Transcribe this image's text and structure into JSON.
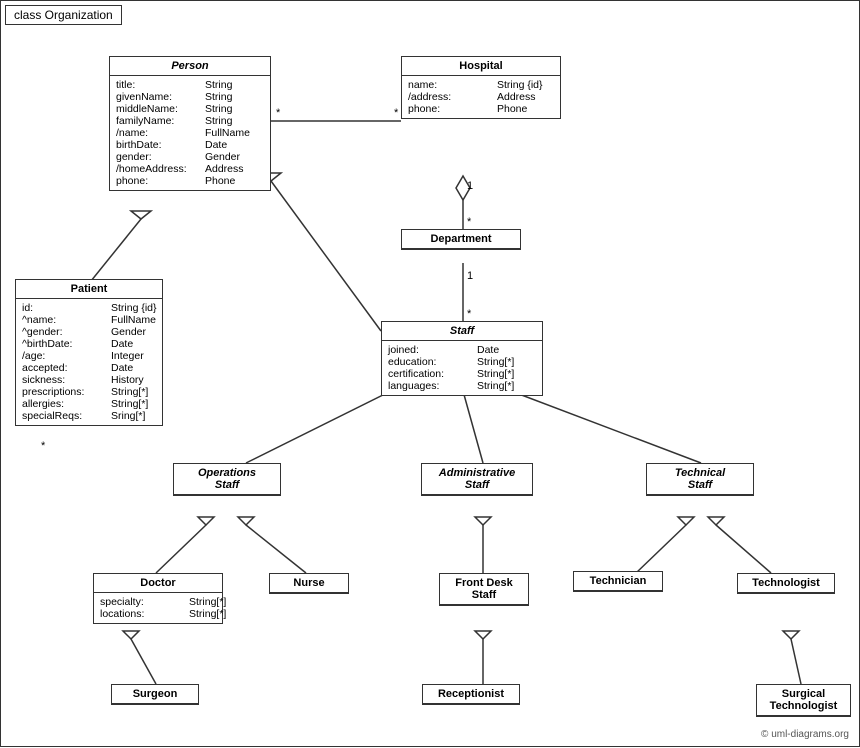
{
  "diagram": {
    "title": "class Organization",
    "copyright": "© uml-diagrams.org",
    "classes": {
      "person": {
        "name": "Person",
        "italic": true,
        "attrs": [
          [
            "title:",
            "String"
          ],
          [
            "givenName:",
            "String"
          ],
          [
            "middleName:",
            "String"
          ],
          [
            "familyName:",
            "String"
          ],
          [
            "/name:",
            "FullName"
          ],
          [
            "birthDate:",
            "Date"
          ],
          [
            "gender:",
            "Gender"
          ],
          [
            "/homeAddress:",
            "Address"
          ],
          [
            "phone:",
            "Phone"
          ]
        ]
      },
      "hospital": {
        "name": "Hospital",
        "italic": false,
        "attrs": [
          [
            "name:",
            "String {id}"
          ],
          [
            "/address:",
            "Address"
          ],
          [
            "phone:",
            "Phone"
          ]
        ]
      },
      "patient": {
        "name": "Patient",
        "italic": false,
        "attrs": [
          [
            "id:",
            "String {id}"
          ],
          [
            "^name:",
            "FullName"
          ],
          [
            "^gender:",
            "Gender"
          ],
          [
            "^birthDate:",
            "Date"
          ],
          [
            "/age:",
            "Integer"
          ],
          [
            "accepted:",
            "Date"
          ],
          [
            "sickness:",
            "History"
          ],
          [
            "prescriptions:",
            "String[*]"
          ],
          [
            "allergies:",
            "String[*]"
          ],
          [
            "specialReqs:",
            "Sring[*]"
          ]
        ]
      },
      "department": {
        "name": "Department",
        "italic": false,
        "attrs": []
      },
      "staff": {
        "name": "Staff",
        "italic": true,
        "attrs": [
          [
            "joined:",
            "Date"
          ],
          [
            "education:",
            "String[*]"
          ],
          [
            "certification:",
            "String[*]"
          ],
          [
            "languages:",
            "String[*]"
          ]
        ]
      },
      "operations_staff": {
        "name": "Operations\nStaff",
        "italic": true,
        "attrs": []
      },
      "administrative_staff": {
        "name": "Administrative\nStaff",
        "italic": true,
        "attrs": []
      },
      "technical_staff": {
        "name": "Technical\nStaff",
        "italic": true,
        "attrs": []
      },
      "doctor": {
        "name": "Doctor",
        "italic": false,
        "attrs": [
          [
            "specialty:",
            "String[*]"
          ],
          [
            "locations:",
            "String[*]"
          ]
        ]
      },
      "nurse": {
        "name": "Nurse",
        "italic": false,
        "attrs": []
      },
      "front_desk_staff": {
        "name": "Front Desk\nStaff",
        "italic": false,
        "attrs": []
      },
      "technician": {
        "name": "Technician",
        "italic": false,
        "attrs": []
      },
      "technologist": {
        "name": "Technologist",
        "italic": false,
        "attrs": []
      },
      "surgeon": {
        "name": "Surgeon",
        "italic": false,
        "attrs": []
      },
      "receptionist": {
        "name": "Receptionist",
        "italic": false,
        "attrs": []
      },
      "surgical_technologist": {
        "name": "Surgical\nTechnologist",
        "italic": false,
        "attrs": []
      }
    }
  }
}
